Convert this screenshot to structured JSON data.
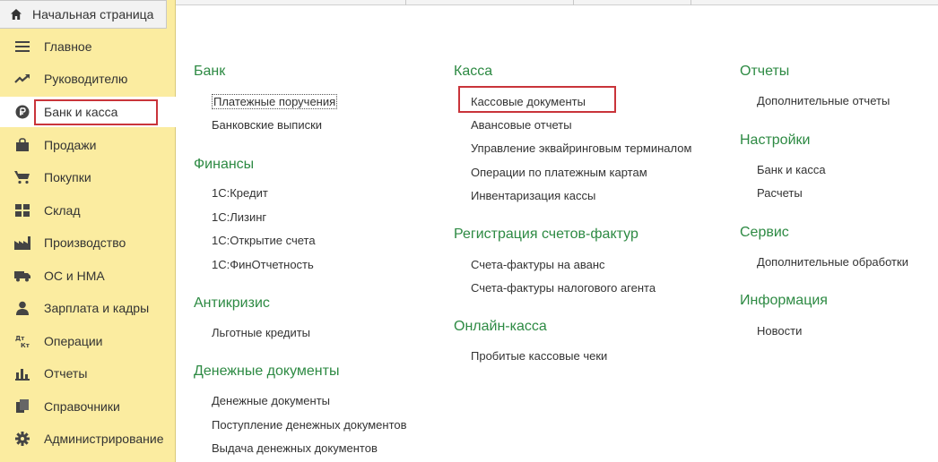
{
  "home_tab": {
    "label": "Начальная страница",
    "icon": "home-icon"
  },
  "sidebar": {
    "items": [
      {
        "label": "Главное",
        "icon": "menu-lines-icon"
      },
      {
        "label": "Руководителю",
        "icon": "trend-icon"
      },
      {
        "label": "Банк и касса",
        "icon": "ruble-coin-icon"
      },
      {
        "label": "Продажи",
        "icon": "shopping-bag-icon"
      },
      {
        "label": "Покупки",
        "icon": "cart-icon"
      },
      {
        "label": "Склад",
        "icon": "warehouse-icon"
      },
      {
        "label": "Производство",
        "icon": "factory-icon"
      },
      {
        "label": "ОС и НМА",
        "icon": "truck-icon"
      },
      {
        "label": "Зарплата и кадры",
        "icon": "person-icon"
      },
      {
        "label": "Операции",
        "icon": "dt-kt-icon"
      },
      {
        "label": "Отчеты",
        "icon": "bar-chart-icon"
      },
      {
        "label": "Справочники",
        "icon": "books-icon"
      },
      {
        "label": "Администрирование",
        "icon": "gear-icon"
      }
    ],
    "active_index": 2
  },
  "columns": [
    {
      "groups": [
        {
          "title": "Банк",
          "links": [
            "Платежные поручения",
            "Банковские выписки"
          ]
        },
        {
          "title": "Финансы",
          "links": [
            "1С:Кредит",
            "1С:Лизинг",
            "1С:Открытие счета",
            "1С:ФинОтчетность"
          ]
        },
        {
          "title": "Антикризис",
          "links": [
            "Льготные кредиты"
          ]
        },
        {
          "title": "Денежные документы",
          "links": [
            "Денежные документы",
            "Поступление денежных документов",
            "Выдача денежных документов"
          ]
        }
      ]
    },
    {
      "groups": [
        {
          "title": "Касса",
          "links": [
            "Кассовые документы",
            "Авансовые отчеты",
            "Управление эквайринговым терминалом",
            "Операции по платежным картам",
            "Инвентаризация кассы"
          ]
        },
        {
          "title": "Регистрация счетов-фактур",
          "links": [
            "Счета-фактуры на аванс",
            "Счета-фактуры налогового агента"
          ]
        },
        {
          "title": "Онлайн-касса",
          "links": [
            "Пробитые кассовые чеки"
          ]
        }
      ]
    },
    {
      "groups": [
        {
          "title": "Отчеты",
          "links": [
            "Дополнительные отчеты"
          ]
        },
        {
          "title": "Настройки",
          "links": [
            "Банк и касса",
            "Расчеты"
          ]
        },
        {
          "title": "Сервис",
          "links": [
            "Дополнительные обработки"
          ]
        },
        {
          "title": "Информация",
          "links": [
            "Новости"
          ]
        }
      ]
    }
  ],
  "colors": {
    "sidebar_bg": "#fbeca0",
    "group_title": "#2d8a43",
    "highlight": "#c9343a"
  }
}
